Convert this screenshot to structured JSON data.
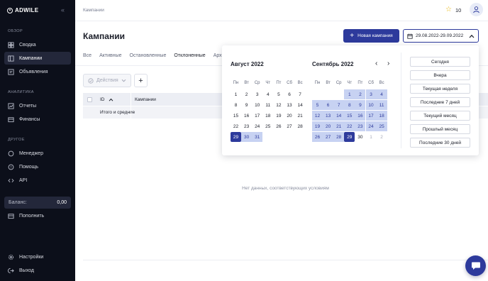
{
  "brand": {
    "name": "ADWILE"
  },
  "sidebar": {
    "sections": [
      {
        "title": "ОБЗОР",
        "items": [
          {
            "label": "Сводка",
            "icon": "dashboard-icon"
          },
          {
            "label": "Кампании",
            "icon": "campaigns-icon",
            "active": true
          },
          {
            "label": "Объявления",
            "icon": "ads-icon"
          }
        ]
      },
      {
        "title": "АНАЛИТИКА",
        "items": [
          {
            "label": "Отчеты",
            "icon": "chart-icon"
          },
          {
            "label": "Финансы",
            "icon": "wallet-icon"
          }
        ]
      },
      {
        "title": "ДРУГОЕ",
        "items": [
          {
            "label": "Менеджер",
            "icon": "chat-icon"
          },
          {
            "label": "Помощь",
            "icon": "help-icon"
          },
          {
            "label": "API",
            "icon": "code-icon"
          }
        ]
      }
    ],
    "balance_label": "Баланс:",
    "balance_value": "0,00",
    "topup_label": "Пополнить",
    "settings_label": "Настройки",
    "logout_label": "Выход"
  },
  "header": {
    "breadcrumb": "Кампании",
    "coins": "10",
    "title": "Кампании",
    "new_campaign_label": "Новая кампания",
    "date_range": "29.08.2022-29.09.2022"
  },
  "tabs": [
    "Все",
    "Активные",
    "Остановленные",
    "Отклоненные",
    "Архив"
  ],
  "active_tab": "Отклоненные",
  "toolbar": {
    "actions_label": "Действия"
  },
  "table": {
    "columns": {
      "id": "ID",
      "campaigns": "Кампании"
    },
    "totals_label": "Итого и средние",
    "empty_text": "Нет данных, соответствующих условиям"
  },
  "calendar": {
    "weekdays": [
      "Пн",
      "Вт",
      "Ср",
      "Чт",
      "Пт",
      "Сб",
      "Вс"
    ],
    "left": {
      "title": "Август 2022",
      "weeks": [
        [
          [
            "1",
            ""
          ],
          [
            "2",
            ""
          ],
          [
            "3",
            ""
          ],
          [
            "4",
            ""
          ],
          [
            "5",
            ""
          ],
          [
            "6",
            ""
          ],
          [
            "7",
            ""
          ]
        ],
        [
          [
            "8",
            ""
          ],
          [
            "9",
            ""
          ],
          [
            "10",
            ""
          ],
          [
            "11",
            ""
          ],
          [
            "12",
            ""
          ],
          [
            "13",
            ""
          ],
          [
            "14",
            ""
          ]
        ],
        [
          [
            "15",
            ""
          ],
          [
            "16",
            ""
          ],
          [
            "17",
            ""
          ],
          [
            "18",
            ""
          ],
          [
            "19",
            ""
          ],
          [
            "20",
            ""
          ],
          [
            "21",
            ""
          ]
        ],
        [
          [
            "22",
            ""
          ],
          [
            "23",
            ""
          ],
          [
            "24",
            ""
          ],
          [
            "25",
            ""
          ],
          [
            "26",
            ""
          ],
          [
            "27",
            ""
          ],
          [
            "28",
            ""
          ]
        ],
        [
          [
            "29",
            "edge"
          ],
          [
            "30",
            "range"
          ],
          [
            "31",
            "range"
          ],
          null,
          null,
          null,
          null
        ]
      ]
    },
    "right": {
      "title": "Сентябрь 2022",
      "weeks": [
        [
          null,
          null,
          null,
          [
            "1",
            "range"
          ],
          [
            "2",
            "range"
          ],
          [
            "3",
            "range"
          ],
          [
            "4",
            "range"
          ]
        ],
        [
          [
            "5",
            "range"
          ],
          [
            "6",
            "range"
          ],
          [
            "7",
            "range"
          ],
          [
            "8",
            "range"
          ],
          [
            "9",
            "range"
          ],
          [
            "10",
            "range"
          ],
          [
            "11",
            "range"
          ]
        ],
        [
          [
            "12",
            "range"
          ],
          [
            "13",
            "range"
          ],
          [
            "14",
            "range"
          ],
          [
            "15",
            "range"
          ],
          [
            "16",
            "range"
          ],
          [
            "17",
            "range"
          ],
          [
            "18",
            "range"
          ]
        ],
        [
          [
            "19",
            "range"
          ],
          [
            "20",
            "range"
          ],
          [
            "21",
            "range"
          ],
          [
            "22",
            "range"
          ],
          [
            "23",
            "range"
          ],
          [
            "24",
            "range"
          ],
          [
            "25",
            "range"
          ]
        ],
        [
          [
            "26",
            "range"
          ],
          [
            "27",
            "range"
          ],
          [
            "28",
            "range"
          ],
          [
            "29",
            "edge"
          ],
          [
            "30",
            ""
          ],
          [
            "1",
            "muted"
          ],
          [
            "2",
            "muted"
          ]
        ]
      ]
    },
    "presets": [
      "Сегодня",
      "Вчера",
      "Текущая неделя",
      "Последние 7 дней",
      "Текущий месяц",
      "Прошлый месяц",
      "Последние 30 дней"
    ]
  },
  "colors": {
    "sidebar_bg": "#0c0f1a",
    "accent": "#2d3a9c",
    "range_bg": "#c7d2f2",
    "star": "#e6b400"
  }
}
